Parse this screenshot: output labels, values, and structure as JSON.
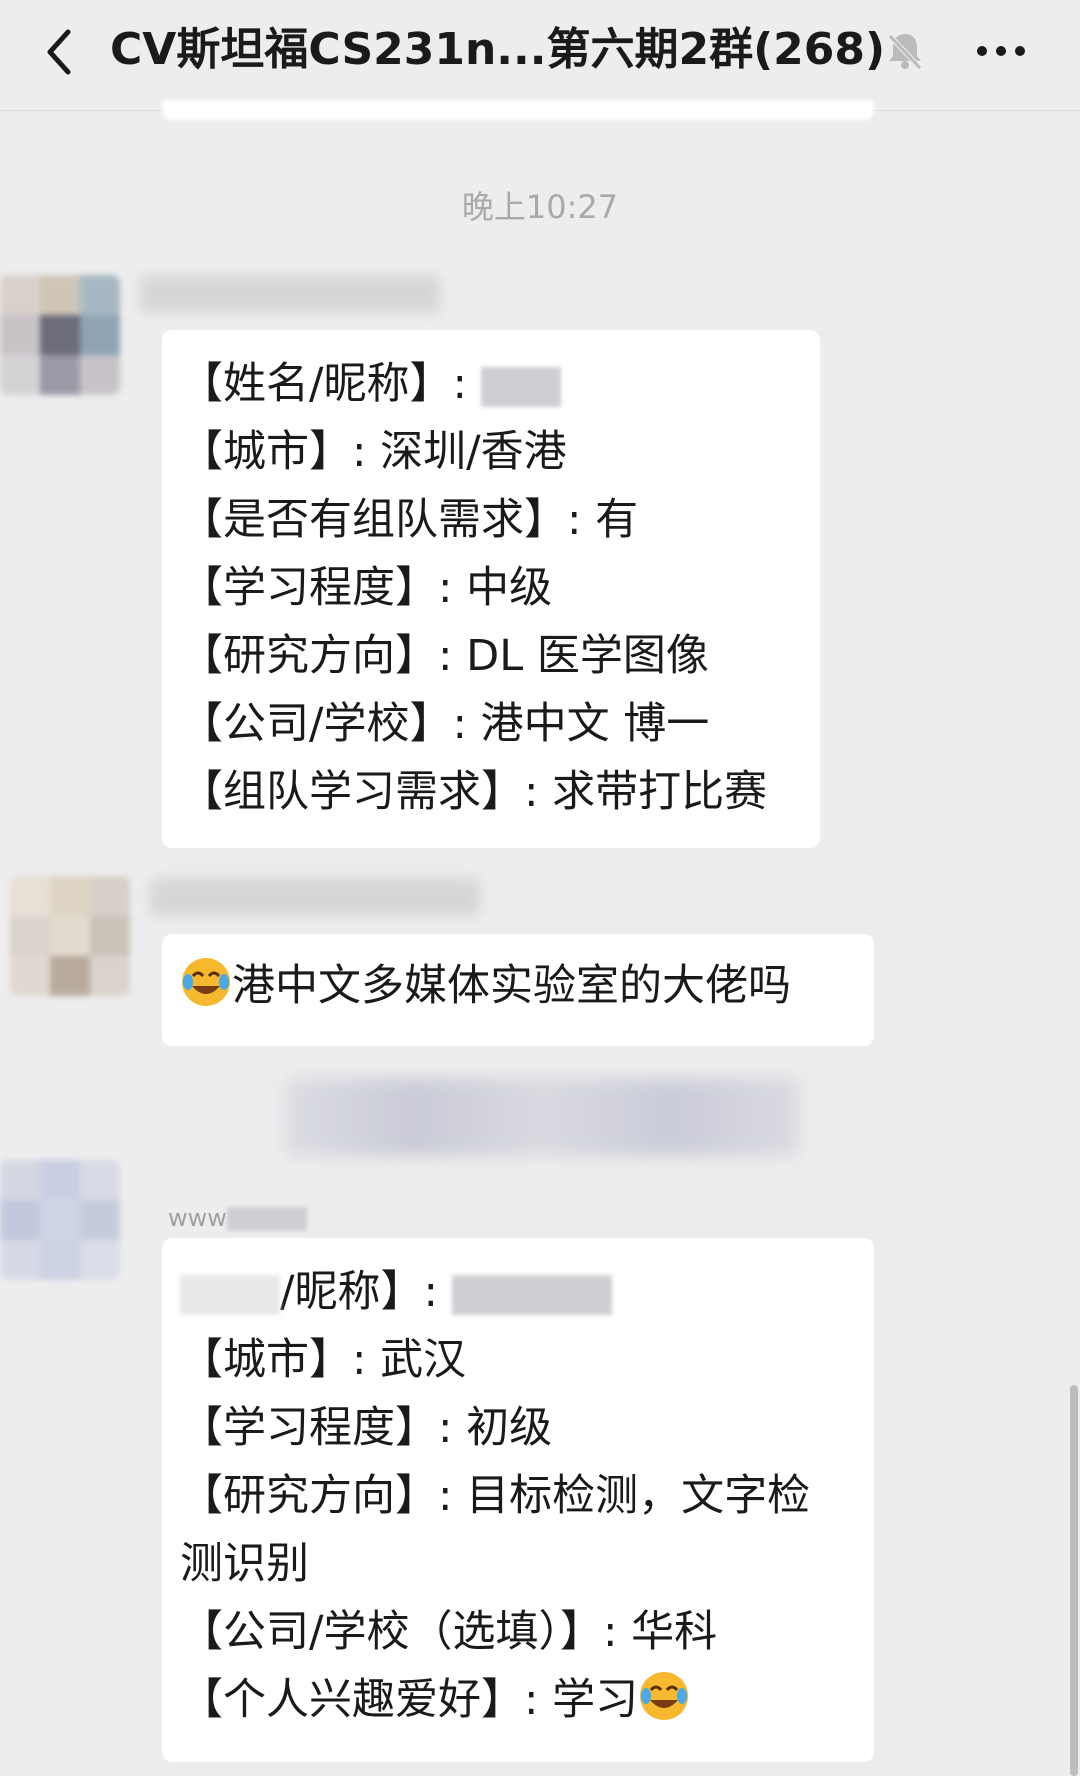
{
  "header": {
    "back_icon": "chevron-left-icon",
    "title": "CV斯坦福CS231n...第六期2群(268)",
    "mute_icon": "bell-muted-icon",
    "more_icon": "more-icon"
  },
  "chat": {
    "timestamp": "晚上10:27",
    "messages": [
      {
        "lines": [
          "【姓名/昵称】: ",
          "【城市】: 深圳/香港",
          "【是否有组队需求】: 有",
          "【学习程度】: 中级",
          "【研究方向】: DL 医学图像",
          "【公司/学校】: 港中文 博一",
          "【组队学习需求】: 求带打比赛"
        ]
      },
      {
        "emoji": "laughing-tears-emoji",
        "text": "港中文多媒体实验室的大佬吗"
      },
      {
        "sender_prefix": "www",
        "lines": [
          "/昵称】: ",
          "【城市】: 武汉",
          "【学习程度】: 初级",
          "【研究方向】: 目标检测，文字检",
          "测识别",
          "【公司/学校（选填）】: 华科",
          "【个人兴趣爱好】: 学习"
        ],
        "trailing_emoji": "laughing-tears-emoji"
      }
    ]
  },
  "colors": {
    "background": "#ededed",
    "bubble": "#ffffff",
    "text": "#1a1a1a",
    "timestamp": "#a9a9a9"
  }
}
